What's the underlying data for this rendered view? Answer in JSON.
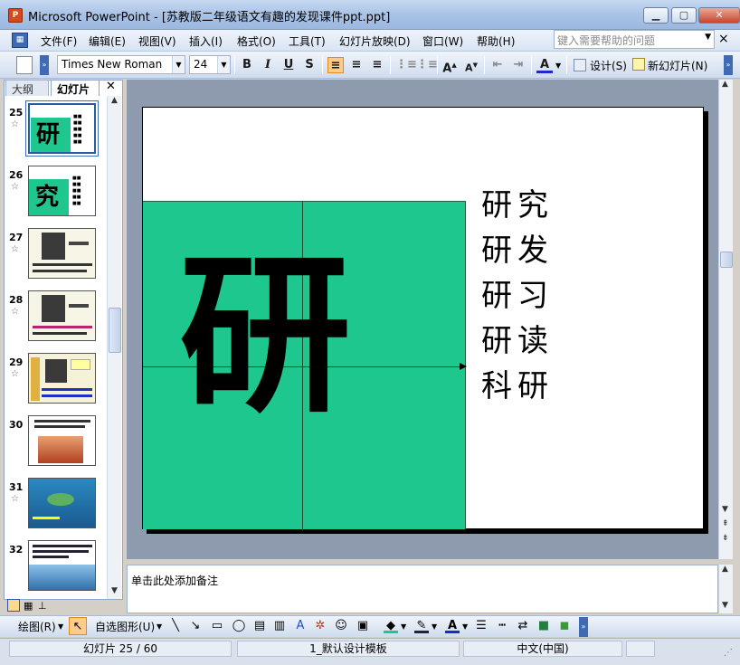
{
  "window": {
    "title": "Microsoft PowerPoint - [苏教版二年级语文有趣的发现课件ppt.ppt]",
    "app_icon": "powerpoint-icon"
  },
  "menu": {
    "items": [
      "文件(F)",
      "编辑(E)",
      "视图(V)",
      "插入(I)",
      "格式(O)",
      "工具(T)",
      "幻灯片放映(D)",
      "窗口(W)",
      "帮助(H)"
    ],
    "help_placeholder": "键入需要帮助的问题"
  },
  "toolbar": {
    "font": "Times New Roman",
    "size": "24",
    "bold": "B",
    "italic": "I",
    "underline": "U",
    "shadow": "S",
    "design_label": "设计(S)",
    "new_slide_label": "新幻灯片(N)"
  },
  "left_pane": {
    "tabs": [
      "大纲",
      "幻灯片"
    ],
    "thumbnails": [
      {
        "num": "25",
        "selected": true,
        "char": "研"
      },
      {
        "num": "26",
        "selected": false,
        "char": "究"
      },
      {
        "num": "27",
        "selected": false,
        "char": ""
      },
      {
        "num": "28",
        "selected": false,
        "char": ""
      },
      {
        "num": "29",
        "selected": false,
        "char": ""
      },
      {
        "num": "30",
        "selected": false,
        "char": ""
      },
      {
        "num": "31",
        "selected": false,
        "char": ""
      },
      {
        "num": "32",
        "selected": false,
        "char": ""
      }
    ]
  },
  "slide": {
    "big_char": "研",
    "words": [
      "研究",
      "研发",
      "研习",
      "研读",
      "科研"
    ],
    "green_color": "#1dc78e"
  },
  "notes": {
    "placeholder": "单击此处添加备注"
  },
  "drawing": {
    "draw_label": "绘图(R)",
    "autoshapes_label": "自选图形(U)"
  },
  "status": {
    "slide_info": "幻灯片 25 / 60",
    "template": "1_默认设计模板",
    "language": "中文(中国)"
  }
}
